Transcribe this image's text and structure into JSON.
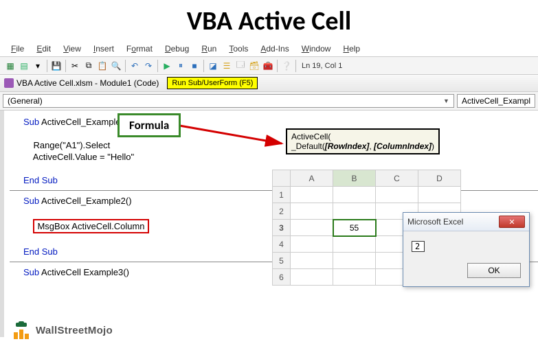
{
  "title": "VBA Active Cell",
  "menu": [
    "File",
    "Edit",
    "View",
    "Insert",
    "Format",
    "Debug",
    "Run",
    "Tools",
    "Add-Ins",
    "Window",
    "Help"
  ],
  "cursor_pos": "Ln 19, Col 1",
  "doc_tab": "VBA Active Cell.xlsm - Module1 (Code)",
  "callout_run": "Run Sub/UserForm (F5)",
  "dropdowns": {
    "left": "(General)",
    "right": "ActiveCell_Exampl"
  },
  "formula_label": "Formula",
  "tooltip": {
    "line1": "ActiveCell(",
    "line2_pre": "_Default(",
    "line2_p1": "[RowIndex]",
    "line2_mid": ", ",
    "line2_p2": "[ColumnIndex]",
    "line2_post": ")"
  },
  "code": {
    "sub1_head": "Sub ActiveCell_Example1()",
    "sub1_l1": "    Range(\"A1\").Select",
    "sub1_l2": "    ActiveCell.Value = \"Hello\"",
    "end": "End Sub",
    "sub2_head": "Sub ActiveCell_Example2()",
    "sub2_l1": "MsgBox ActiveCell.Column",
    "sub3_head": "Sub ActiveCell Example3()"
  },
  "sheet": {
    "cols": [
      "A",
      "B",
      "C",
      "D"
    ],
    "rows": [
      "1",
      "2",
      "3",
      "4",
      "5",
      "6"
    ],
    "active_value": "55",
    "active_row": 3,
    "active_col": "B"
  },
  "msgbox": {
    "title": "Microsoft Excel",
    "value": "2",
    "ok": "OK"
  },
  "watermark": "WallStreetMojo"
}
